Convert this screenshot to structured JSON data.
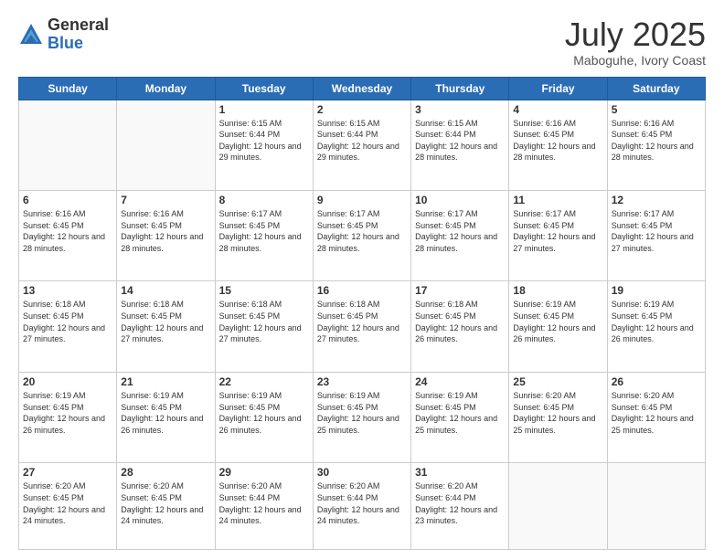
{
  "logo": {
    "general": "General",
    "blue": "Blue"
  },
  "header": {
    "month": "July 2025",
    "location": "Maboguhe, Ivory Coast"
  },
  "weekdays": [
    "Sunday",
    "Monday",
    "Tuesday",
    "Wednesday",
    "Thursday",
    "Friday",
    "Saturday"
  ],
  "weeks": [
    [
      {
        "day": "",
        "info": ""
      },
      {
        "day": "",
        "info": ""
      },
      {
        "day": "1",
        "info": "Sunrise: 6:15 AM\nSunset: 6:44 PM\nDaylight: 12 hours and 29 minutes."
      },
      {
        "day": "2",
        "info": "Sunrise: 6:15 AM\nSunset: 6:44 PM\nDaylight: 12 hours and 29 minutes."
      },
      {
        "day": "3",
        "info": "Sunrise: 6:15 AM\nSunset: 6:44 PM\nDaylight: 12 hours and 28 minutes."
      },
      {
        "day": "4",
        "info": "Sunrise: 6:16 AM\nSunset: 6:45 PM\nDaylight: 12 hours and 28 minutes."
      },
      {
        "day": "5",
        "info": "Sunrise: 6:16 AM\nSunset: 6:45 PM\nDaylight: 12 hours and 28 minutes."
      }
    ],
    [
      {
        "day": "6",
        "info": "Sunrise: 6:16 AM\nSunset: 6:45 PM\nDaylight: 12 hours and 28 minutes."
      },
      {
        "day": "7",
        "info": "Sunrise: 6:16 AM\nSunset: 6:45 PM\nDaylight: 12 hours and 28 minutes."
      },
      {
        "day": "8",
        "info": "Sunrise: 6:17 AM\nSunset: 6:45 PM\nDaylight: 12 hours and 28 minutes."
      },
      {
        "day": "9",
        "info": "Sunrise: 6:17 AM\nSunset: 6:45 PM\nDaylight: 12 hours and 28 minutes."
      },
      {
        "day": "10",
        "info": "Sunrise: 6:17 AM\nSunset: 6:45 PM\nDaylight: 12 hours and 28 minutes."
      },
      {
        "day": "11",
        "info": "Sunrise: 6:17 AM\nSunset: 6:45 PM\nDaylight: 12 hours and 27 minutes."
      },
      {
        "day": "12",
        "info": "Sunrise: 6:17 AM\nSunset: 6:45 PM\nDaylight: 12 hours and 27 minutes."
      }
    ],
    [
      {
        "day": "13",
        "info": "Sunrise: 6:18 AM\nSunset: 6:45 PM\nDaylight: 12 hours and 27 minutes."
      },
      {
        "day": "14",
        "info": "Sunrise: 6:18 AM\nSunset: 6:45 PM\nDaylight: 12 hours and 27 minutes."
      },
      {
        "day": "15",
        "info": "Sunrise: 6:18 AM\nSunset: 6:45 PM\nDaylight: 12 hours and 27 minutes."
      },
      {
        "day": "16",
        "info": "Sunrise: 6:18 AM\nSunset: 6:45 PM\nDaylight: 12 hours and 27 minutes."
      },
      {
        "day": "17",
        "info": "Sunrise: 6:18 AM\nSunset: 6:45 PM\nDaylight: 12 hours and 26 minutes."
      },
      {
        "day": "18",
        "info": "Sunrise: 6:19 AM\nSunset: 6:45 PM\nDaylight: 12 hours and 26 minutes."
      },
      {
        "day": "19",
        "info": "Sunrise: 6:19 AM\nSunset: 6:45 PM\nDaylight: 12 hours and 26 minutes."
      }
    ],
    [
      {
        "day": "20",
        "info": "Sunrise: 6:19 AM\nSunset: 6:45 PM\nDaylight: 12 hours and 26 minutes."
      },
      {
        "day": "21",
        "info": "Sunrise: 6:19 AM\nSunset: 6:45 PM\nDaylight: 12 hours and 26 minutes."
      },
      {
        "day": "22",
        "info": "Sunrise: 6:19 AM\nSunset: 6:45 PM\nDaylight: 12 hours and 26 minutes."
      },
      {
        "day": "23",
        "info": "Sunrise: 6:19 AM\nSunset: 6:45 PM\nDaylight: 12 hours and 25 minutes."
      },
      {
        "day": "24",
        "info": "Sunrise: 6:19 AM\nSunset: 6:45 PM\nDaylight: 12 hours and 25 minutes."
      },
      {
        "day": "25",
        "info": "Sunrise: 6:20 AM\nSunset: 6:45 PM\nDaylight: 12 hours and 25 minutes."
      },
      {
        "day": "26",
        "info": "Sunrise: 6:20 AM\nSunset: 6:45 PM\nDaylight: 12 hours and 25 minutes."
      }
    ],
    [
      {
        "day": "27",
        "info": "Sunrise: 6:20 AM\nSunset: 6:45 PM\nDaylight: 12 hours and 24 minutes."
      },
      {
        "day": "28",
        "info": "Sunrise: 6:20 AM\nSunset: 6:45 PM\nDaylight: 12 hours and 24 minutes."
      },
      {
        "day": "29",
        "info": "Sunrise: 6:20 AM\nSunset: 6:44 PM\nDaylight: 12 hours and 24 minutes."
      },
      {
        "day": "30",
        "info": "Sunrise: 6:20 AM\nSunset: 6:44 PM\nDaylight: 12 hours and 24 minutes."
      },
      {
        "day": "31",
        "info": "Sunrise: 6:20 AM\nSunset: 6:44 PM\nDaylight: 12 hours and 23 minutes."
      },
      {
        "day": "",
        "info": ""
      },
      {
        "day": "",
        "info": ""
      }
    ]
  ]
}
